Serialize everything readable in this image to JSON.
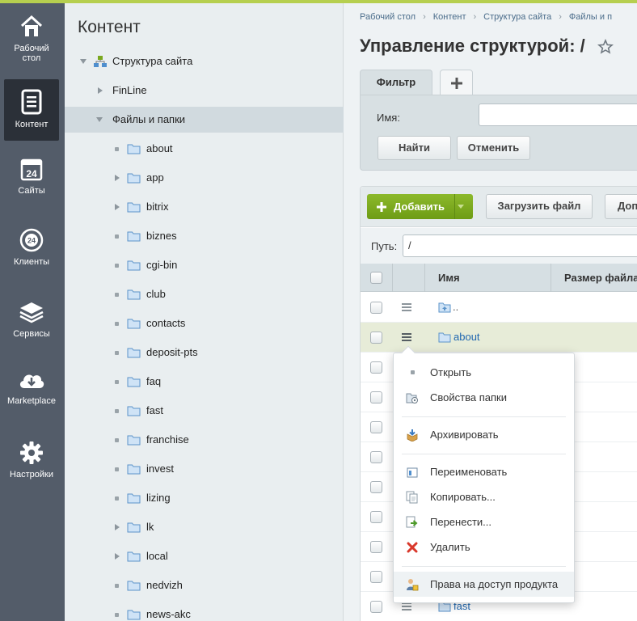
{
  "leftnav": {
    "items": [
      {
        "label": "Рабочий стол",
        "icon": "home-icon"
      },
      {
        "label": "Контент",
        "icon": "document-icon",
        "active": true
      },
      {
        "label": "Сайты",
        "icon": "calendar-24-icon"
      },
      {
        "label": "Клиенты",
        "icon": "clients-24-icon"
      },
      {
        "label": "Сервисы",
        "icon": "layers-icon"
      },
      {
        "label": "Marketplace",
        "icon": "cloud-download-icon"
      },
      {
        "label": "Настройки",
        "icon": "gear-icon"
      }
    ]
  },
  "tree": {
    "title": "Контент",
    "root": "Структура сайта",
    "items": [
      {
        "label": "FinLine",
        "expandable": true
      },
      {
        "label": "Файлы и папки",
        "expanded": true
      },
      {
        "label": "about",
        "expandable": false
      },
      {
        "label": "app",
        "expandable": true
      },
      {
        "label": "bitrix",
        "expandable": true
      },
      {
        "label": "biznes",
        "expandable": false
      },
      {
        "label": "cgi-bin",
        "expandable": false
      },
      {
        "label": "club",
        "expandable": false
      },
      {
        "label": "contacts",
        "expandable": false
      },
      {
        "label": "deposit-pts",
        "expandable": false
      },
      {
        "label": "faq",
        "expandable": false
      },
      {
        "label": "fast",
        "expandable": false
      },
      {
        "label": "franchise",
        "expandable": false
      },
      {
        "label": "invest",
        "expandable": false
      },
      {
        "label": "lizing",
        "expandable": false
      },
      {
        "label": "lk",
        "expandable": true
      },
      {
        "label": "local",
        "expandable": true
      },
      {
        "label": "nedvizh",
        "expandable": false
      },
      {
        "label": "news-akc",
        "expandable": false
      }
    ]
  },
  "main": {
    "breadcrumb": [
      "Рабочий стол",
      "Контент",
      "Структура сайта",
      "Файлы и п"
    ],
    "title": "Управление структурой: /",
    "filter": {
      "tab": "Фильтр",
      "name_label": "Имя:",
      "find": "Найти",
      "cancel": "Отменить"
    },
    "toolbar": {
      "add": "Добавить",
      "upload": "Загрузить файл",
      "more": "Доп"
    },
    "path": {
      "label": "Путь:",
      "value": "/"
    },
    "columns": {
      "name": "Имя",
      "size": "Размер файла"
    },
    "rows": [
      {
        "name": ".."
      },
      {
        "name": "about"
      },
      {
        "name": "fast"
      }
    ]
  },
  "context_menu": {
    "items": [
      {
        "label": "Открыть",
        "icon": "dot-icon"
      },
      {
        "label": "Свойства папки",
        "icon": "folder-properties-icon"
      },
      {
        "label": "Архивировать",
        "icon": "archive-icon"
      },
      {
        "label": "Переименовать",
        "icon": "rename-icon"
      },
      {
        "label": "Копировать...",
        "icon": "copy-icon"
      },
      {
        "label": "Перенести...",
        "icon": "move-icon"
      },
      {
        "label": "Удалить",
        "icon": "delete-icon"
      },
      {
        "label": "Права на доступ продукта",
        "icon": "access-rights-icon"
      }
    ]
  },
  "colors": {
    "accent_green": "#7aa81f",
    "nav_bg": "#535c69",
    "link": "#2067b0"
  }
}
